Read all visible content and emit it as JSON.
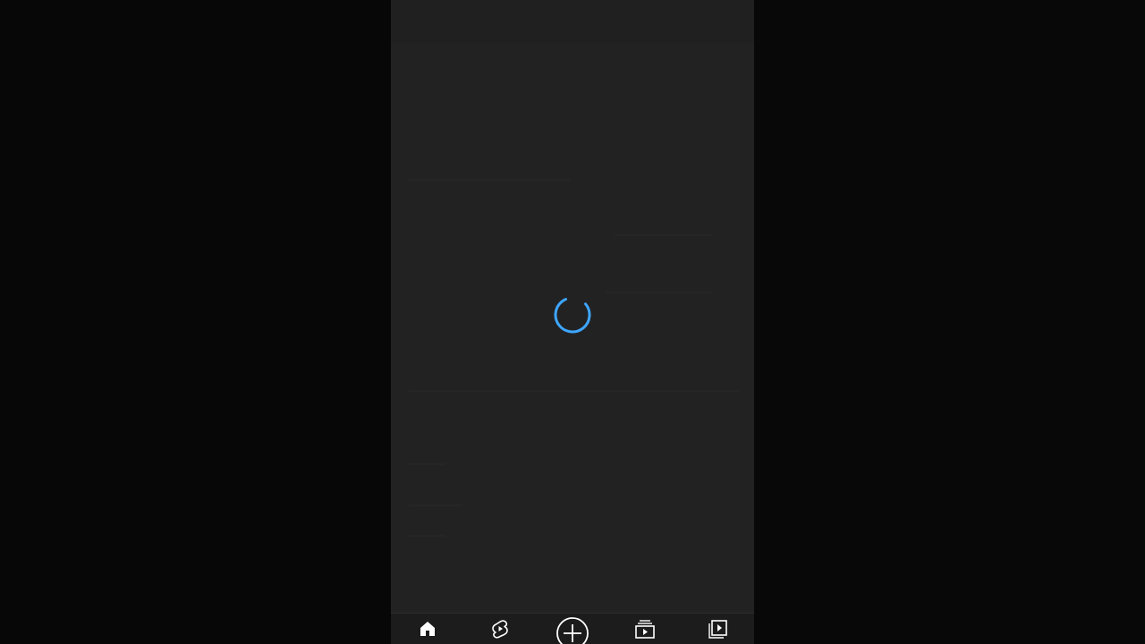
{
  "app": {
    "state": "loading"
  },
  "spinner": {
    "icon": "loading-spinner-icon",
    "color": "#3ea6ff"
  },
  "bottom_nav": {
    "items": [
      {
        "icon": "home-icon"
      },
      {
        "icon": "shorts-icon"
      },
      {
        "icon": "create-plus-icon"
      },
      {
        "icon": "subscriptions-icon"
      },
      {
        "icon": "library-icon"
      }
    ]
  },
  "colors": {
    "background": "#050505",
    "panel": "#222223",
    "nav_background": "#1c1c1d",
    "icon": "#ffffff"
  }
}
